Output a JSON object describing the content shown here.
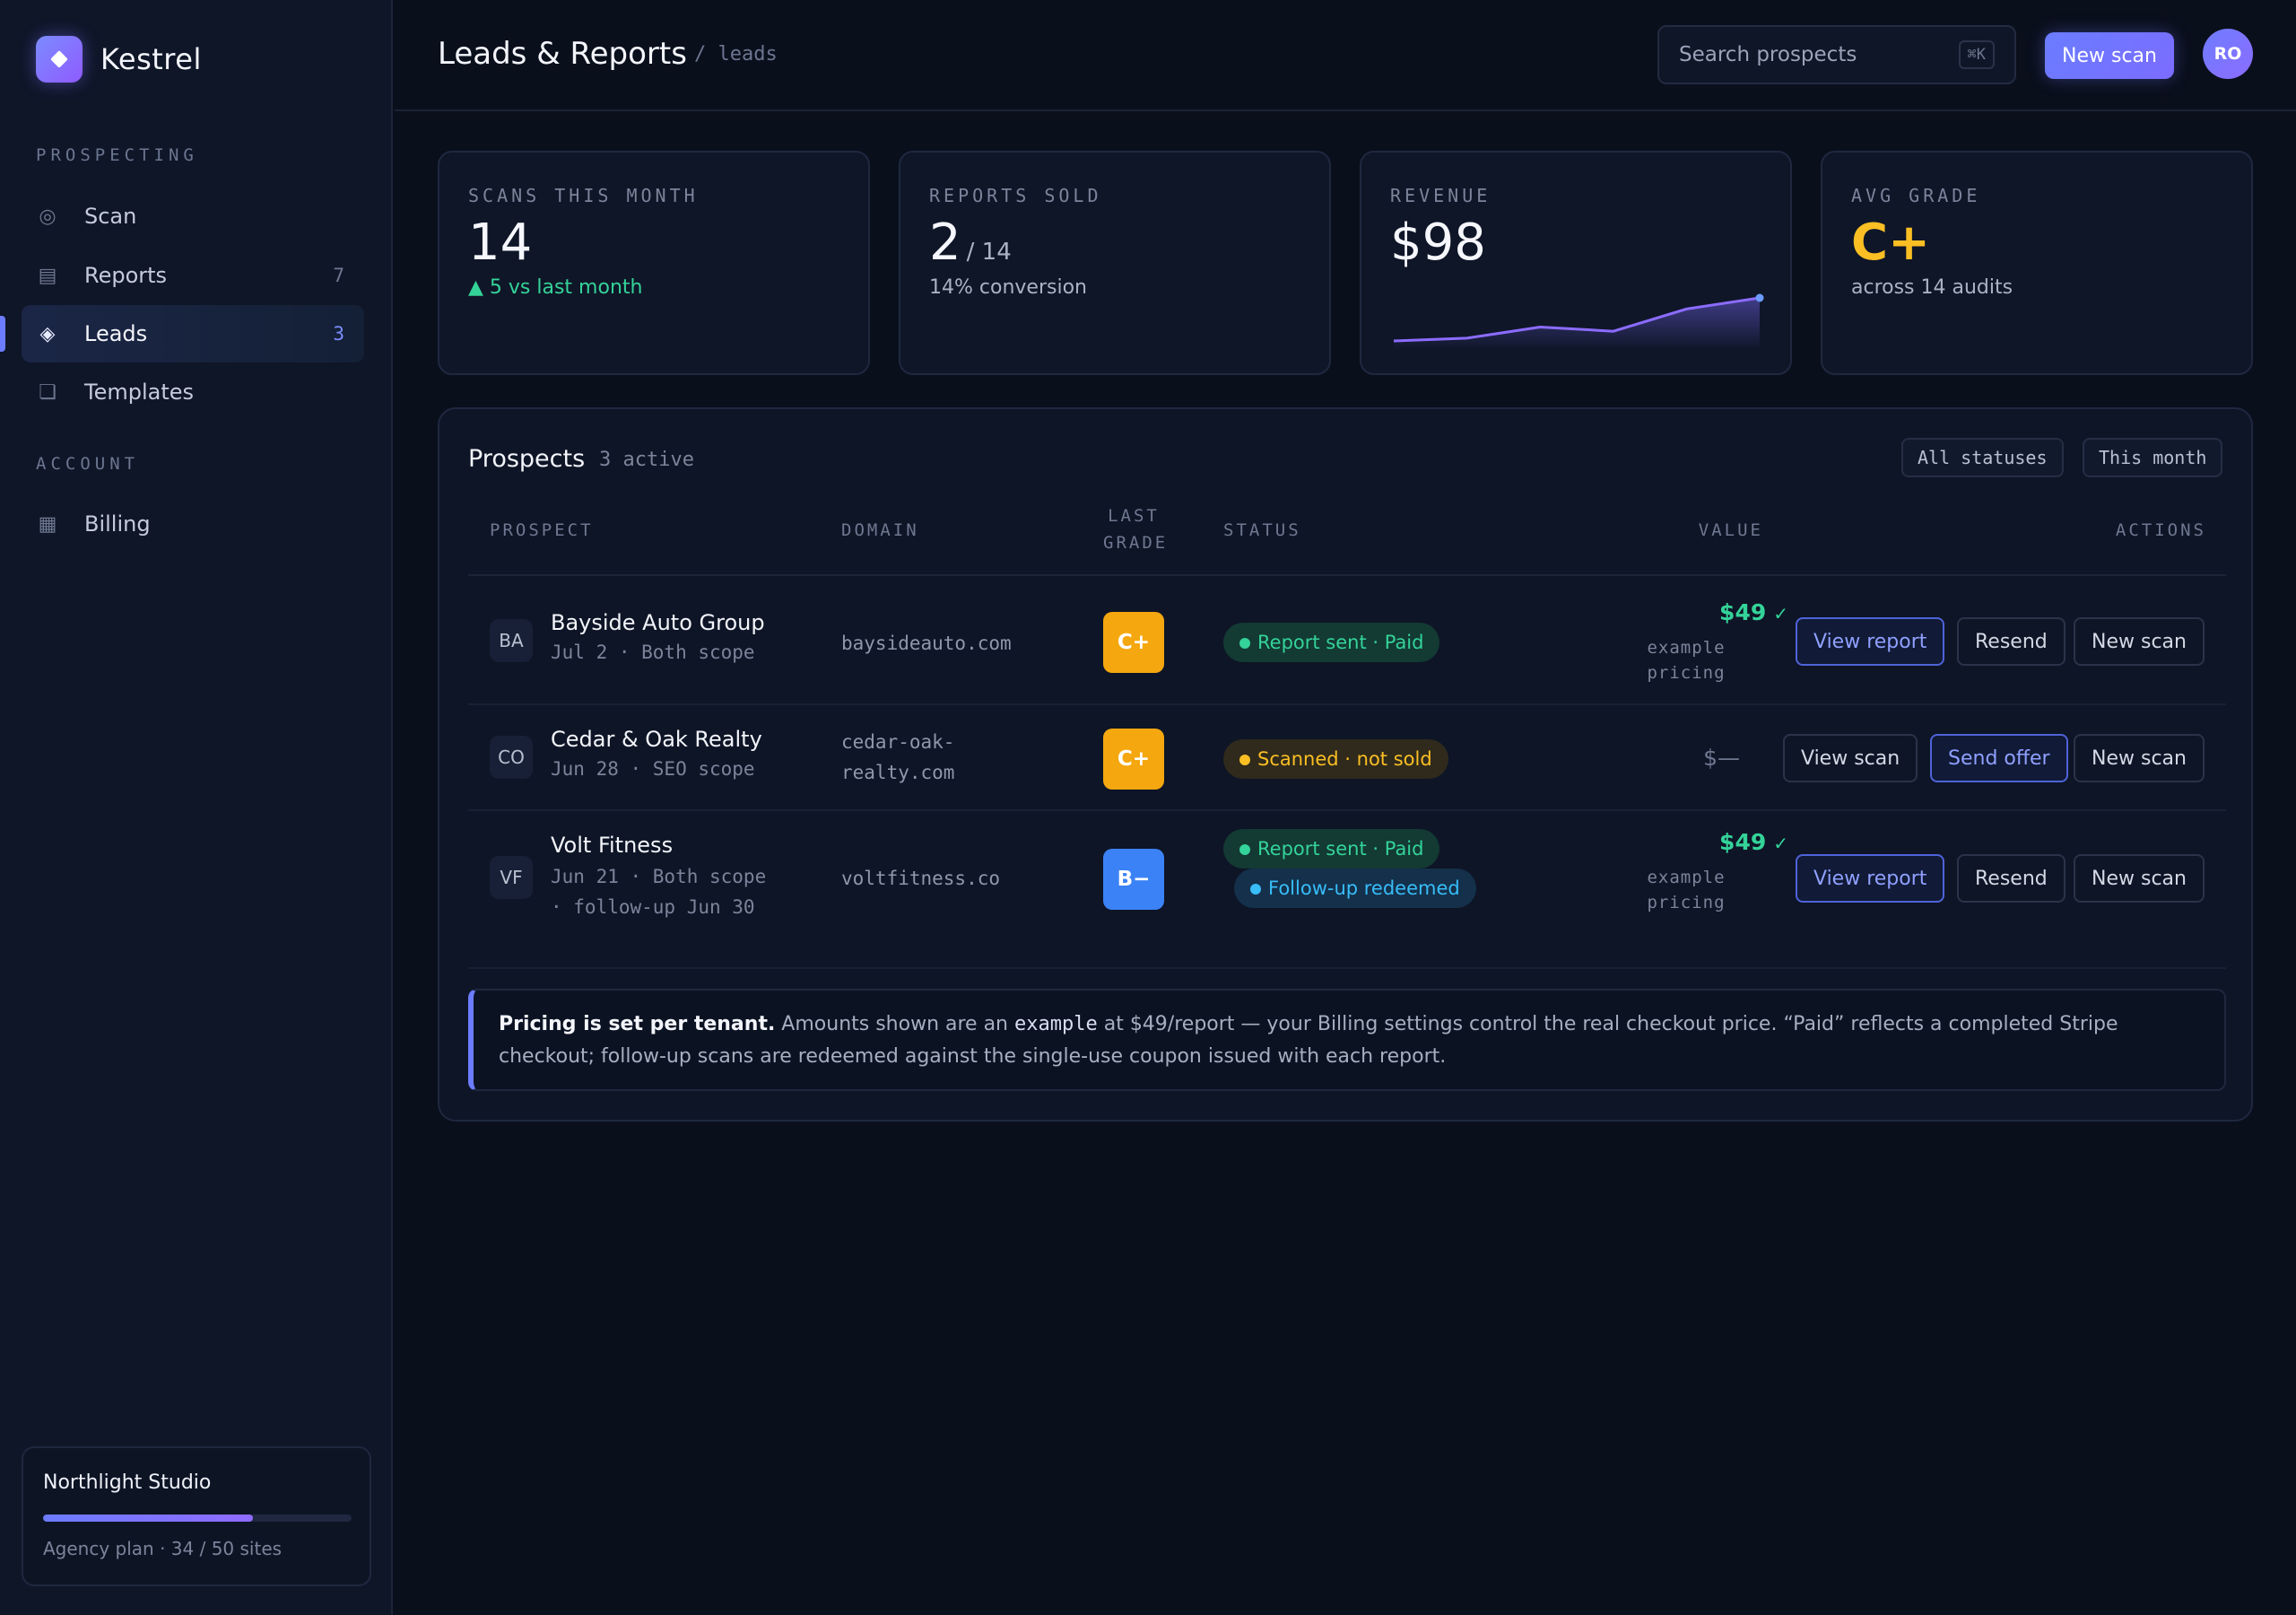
{
  "sidebar": {
    "brand": "Kestrel",
    "section_prospecting": "PROSPECTING",
    "items": [
      {
        "label": "Scan",
        "count": ""
      },
      {
        "label": "Reports",
        "count": "7"
      },
      {
        "label": "Leads",
        "count": "3"
      },
      {
        "label": "Templates",
        "count": ""
      }
    ],
    "section_account": "ACCOUNT",
    "account_items": [
      {
        "label": "Billing"
      }
    ],
    "workspace": {
      "name": "Northlight Studio",
      "plan": "Agency plan · 34 / 50 sites",
      "usage_fraction": 0.68
    }
  },
  "header": {
    "title": "Leads & Reports",
    "breadcrumb": "/ leads",
    "search_placeholder": "Search prospects",
    "search_shortcut": "⌘K",
    "new_scan_label": "New scan",
    "avatar_initials": "RO"
  },
  "stats": [
    {
      "label": "SCANS THIS MONTH",
      "value": "14",
      "suffix": "",
      "note": "▲ 5 vs last month"
    },
    {
      "label": "REPORTS SOLD",
      "value": "2",
      "suffix": "/ 14",
      "note": "14% conversion"
    },
    {
      "label": "REVENUE",
      "value": "$98",
      "suffix": "",
      "note": ""
    },
    {
      "label": "AVG GRADE",
      "value": "C+",
      "suffix": "",
      "note": "across 14 audits"
    }
  ],
  "revenue_trend": [
    2,
    4,
    12,
    9,
    25,
    33
  ],
  "prospects": {
    "title": "Prospects",
    "count": "3 active",
    "filter_status": "All statuses",
    "filter_period": "This month",
    "columns": {
      "prospect": "PROSPECT",
      "domain": "DOMAIN",
      "last_grade_line1": "LAST",
      "last_grade_line2": "GRADE",
      "status": "STATUS",
      "value": "VALUE",
      "actions": "ACTIONS"
    },
    "rows": [
      {
        "initials": "BA",
        "name": "Bayside Auto Group",
        "meta": "Jul 2 · Both scope",
        "domain": "baysideauto.com",
        "grade": "C+",
        "status": "Report sent · Paid",
        "status2": "",
        "value": "$49",
        "value_note_line1": "example",
        "value_note_line2": "pricing",
        "actions": [
          "View report",
          "Resend",
          "New scan"
        ]
      },
      {
        "initials": "CO",
        "name": "Cedar & Oak Realty",
        "meta": "Jun 28 · SEO scope",
        "domain_line1": "cedar-oak-",
        "domain_line2": "realty.com",
        "grade": "C+",
        "status": "Scanned · not sold",
        "status2": "",
        "value": "$—",
        "actions": [
          "View scan",
          "Send offer",
          "New scan"
        ]
      },
      {
        "initials": "VF",
        "name": "Volt Fitness",
        "meta_line1": "Jun 21 · Both scope",
        "meta_line2": "· follow-up Jun 30",
        "domain": "voltfitness.co",
        "grade": "B−",
        "status": "Report sent · Paid",
        "status2": "Follow-up redeemed",
        "value": "$49",
        "value_note_line1": "example",
        "value_note_line2": "pricing",
        "actions": [
          "View report",
          "Resend",
          "New scan"
        ]
      }
    ],
    "notice": {
      "bold": "Pricing is set per tenant.",
      "text_before": " Amounts shown are an ",
      "code": "example",
      "text_after": " at $49/report — your Billing settings control the real checkout price. “Paid” reflects a completed Stripe checkout; follow-up scans are redeemed against the single-use coupon issued with each report."
    }
  },
  "colors": {
    "accent": "#6c7cff",
    "paid": "#34d399",
    "unsold": "#fbbf24",
    "followup": "#38bdf8",
    "grade_c": "#f5a70f",
    "grade_b": "#3b82f6"
  }
}
